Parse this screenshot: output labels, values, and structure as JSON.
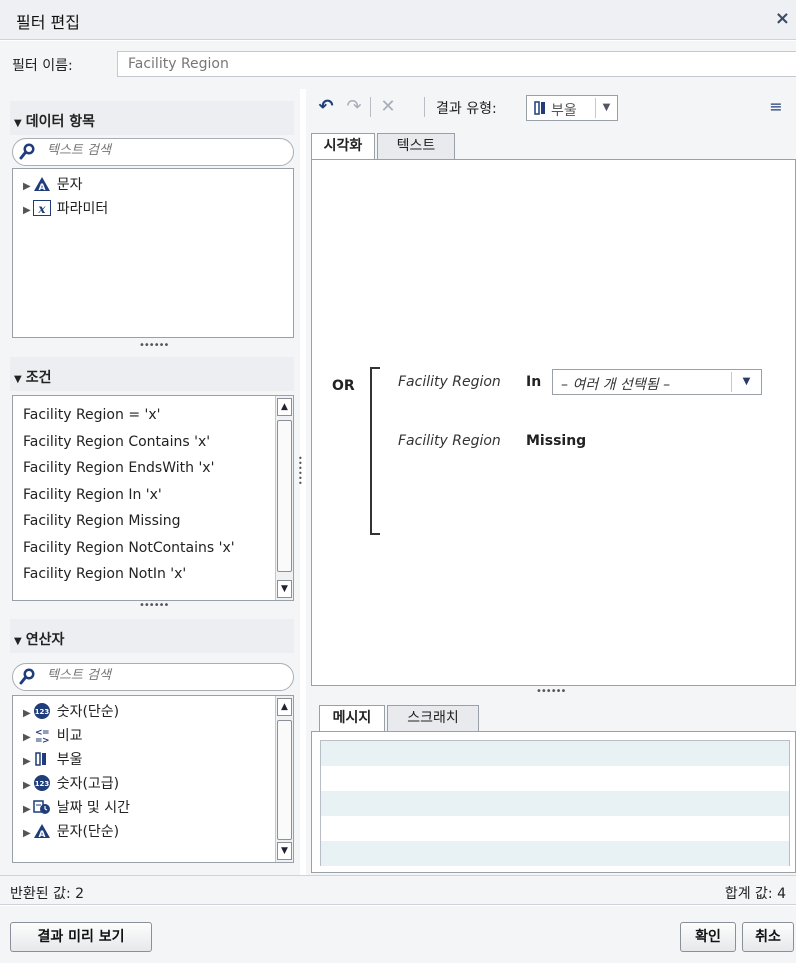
{
  "dialog": {
    "title": "필터 편집",
    "close_glyph": "×"
  },
  "filter_name": {
    "label": "필터 이름:",
    "value": "Facility Region"
  },
  "data_items": {
    "header": "데이터 항목",
    "search_placeholder": "텍스트 검색",
    "items": [
      {
        "label": "문자",
        "icon": "character-icon"
      },
      {
        "label": "파라미터",
        "icon": "parameter-icon"
      }
    ]
  },
  "conditions": {
    "header": "조건",
    "items": [
      "Facility Region = 'x'",
      "Facility Region Contains 'x'",
      "Facility Region EndsWith 'x'",
      "Facility Region In 'x'",
      "Facility Region Missing",
      "Facility Region NotContains 'x'",
      "Facility Region NotIn 'x'"
    ]
  },
  "operators": {
    "header": "연산자",
    "search_placeholder": "텍스트 검색",
    "items": [
      {
        "label": "숫자(단순)",
        "icon": "numeric-icon"
      },
      {
        "label": "비교",
        "icon": "comparison-icon"
      },
      {
        "label": "부울",
        "icon": "boolean-icon"
      },
      {
        "label": "숫자(고급)",
        "icon": "numeric-icon"
      },
      {
        "label": "날짜 및 시간",
        "icon": "datetime-icon"
      },
      {
        "label": "문자(단순)",
        "icon": "character-icon"
      }
    ]
  },
  "toolbar": {
    "result_type_label": "결과 유형:",
    "result_type_value": "부울"
  },
  "editor_tabs": {
    "visual": "시각화",
    "text": "텍스트"
  },
  "expression": {
    "or_label": "OR",
    "field1": "Facility Region",
    "op1": "In",
    "value1": "– 여러 개 선택됨 –",
    "field2": "Facility Region",
    "op2": "Missing"
  },
  "message_tabs": {
    "messages": "메시지",
    "scratch": "스크래치"
  },
  "status": {
    "returned": "반환된 값:  2",
    "total": "합계 값:  4"
  },
  "footer": {
    "preview": "결과 미리 보기",
    "ok": "확인",
    "cancel": "취소"
  },
  "colors": {
    "accent": "#1f3d7a",
    "panel_bg": "#f4f5f7",
    "row_alt": "#e8f2f4"
  }
}
